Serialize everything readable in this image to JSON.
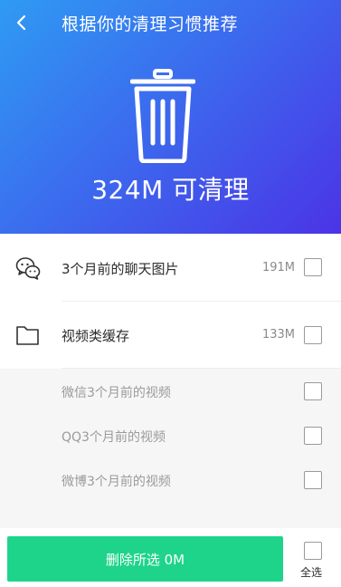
{
  "header": {
    "title": "根据你的清理习惯推荐",
    "back_icon": "chevron-left-icon"
  },
  "hero": {
    "icon": "trash-icon",
    "size_text": "324M 可清理",
    "gradient": [
      "#2f9bf3",
      "#4b34e6"
    ]
  },
  "items": [
    {
      "icon": "wechat-icon",
      "label": "3个月前的聊天图片",
      "size": "191M",
      "checked": false
    },
    {
      "icon": "folder-icon",
      "label": "视频类缓存",
      "size": "133M",
      "checked": false
    }
  ],
  "video_cache_subitems": [
    {
      "label": "微信3个月前的视频",
      "checked": false
    },
    {
      "label": "QQ3个月前的视频",
      "checked": false
    },
    {
      "label": "微博3个月前的视频",
      "checked": false
    }
  ],
  "footer": {
    "delete_label": "删除所选 0M",
    "select_all_label": "全选",
    "accent": "#1ed48a"
  }
}
